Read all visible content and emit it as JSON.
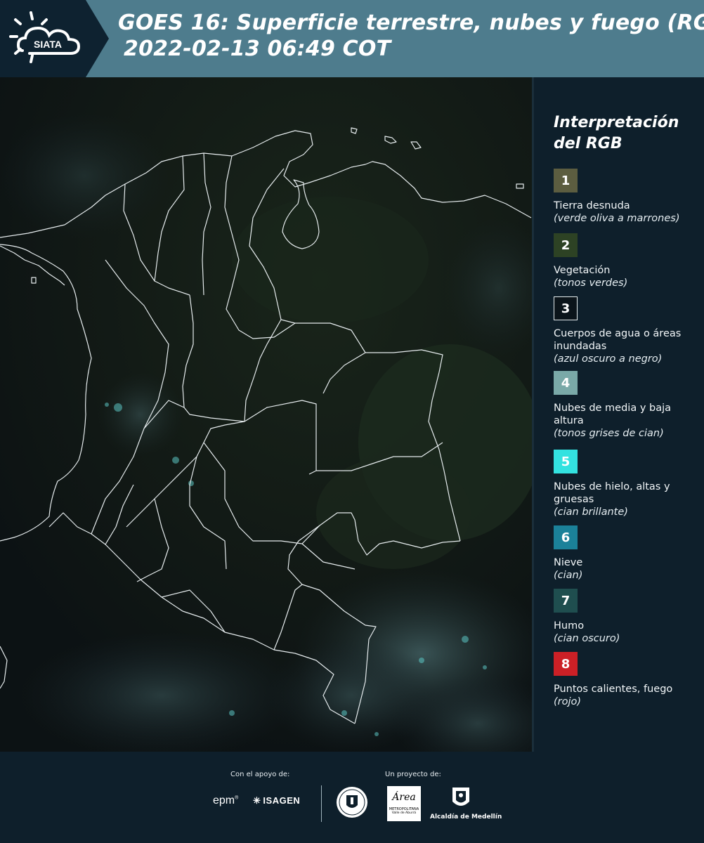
{
  "header": {
    "logo_text": "SIATA",
    "title_line1": "GOES 16: Superficie terrestre, nubes y fuego (RGB)",
    "title_line2": "2022-02-13 06:49 COT"
  },
  "legend": {
    "title_line1": "Interpretación",
    "title_line2": "del RGB",
    "items": [
      {
        "num": "1",
        "color": "#5c5d40",
        "label": "Tierra desnuda",
        "desc": "(verde oliva a marrones)"
      },
      {
        "num": "2",
        "color": "#2d4224",
        "label": "Vegetación",
        "desc": "(tonos verdes)"
      },
      {
        "num": "3",
        "color": "#0b141a",
        "label": "Cuerpos de agua o áreas inundadas",
        "desc": "(azul oscuro a negro)"
      },
      {
        "num": "4",
        "color": "#7aa9a8",
        "label": "Nubes de media y baja altura",
        "desc": "(tonos grises de cian)"
      },
      {
        "num": "5",
        "color": "#33e2e0",
        "label": "Nubes de hielo, altas y gruesas",
        "desc": "(cian brillante)"
      },
      {
        "num": "6",
        "color": "#1b8199",
        "label": "Nieve",
        "desc": "(cian)"
      },
      {
        "num": "7",
        "color": "#1f4e4f",
        "label": "Humo",
        "desc": "(cian oscuro)"
      },
      {
        "num": "8",
        "color": "#cc2026",
        "label": "Puntos calientes, fuego",
        "desc": "(rojo)"
      }
    ]
  },
  "footer": {
    "support_caption": "Con el apoyo de:",
    "project_caption": "Un proyecto de:",
    "sponsors": [
      "epm",
      "ISAGEN",
      "Área Metropolitana",
      "Alcaldía de Medellín"
    ],
    "area_line1": "Área",
    "area_line2": "METROPOLITANA",
    "area_line3": "Valle de Aburrá",
    "alcaldia": "Alcaldía de Medellín"
  }
}
